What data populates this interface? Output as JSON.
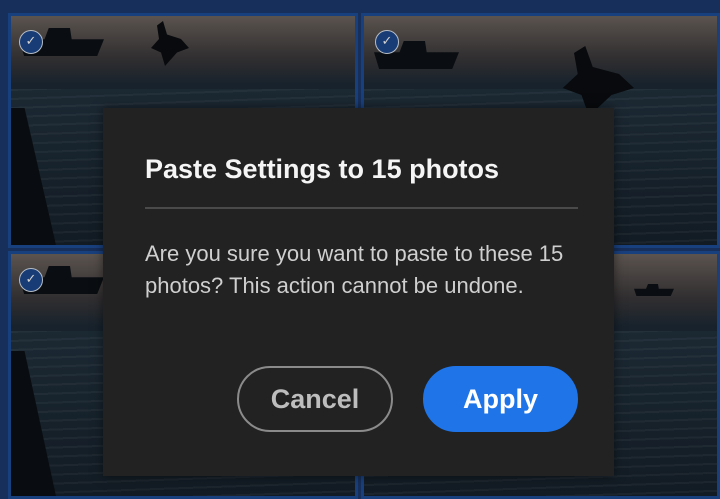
{
  "dialog": {
    "title": "Paste Settings to 15 photos",
    "message": "Are you sure you want to paste to these 15 photos? This action cannot be undone.",
    "cancel_label": "Cancel",
    "apply_label": "Apply"
  },
  "photo_grid": {
    "check_glyph": "✓",
    "selection_color": "#1f4f9a",
    "tiles": [
      {
        "selected": true
      },
      {
        "selected": true
      },
      {
        "selected": true
      },
      {
        "selected": false
      }
    ]
  },
  "colors": {
    "dialog_background": "#222222",
    "apply_accent": "#1f75e8",
    "cancel_border": "#8b8b8b"
  }
}
